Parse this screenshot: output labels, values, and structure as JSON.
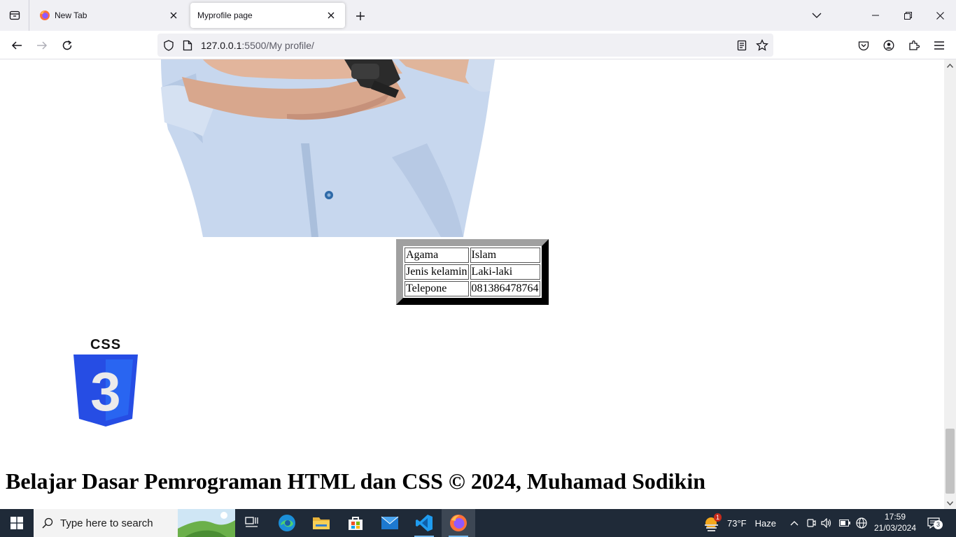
{
  "browser": {
    "tabs": [
      {
        "title": "New Tab",
        "active": false
      },
      {
        "title": "Myprofile page",
        "active": true
      }
    ],
    "url_host": "127.0.0.1",
    "url_rest": ":5500/My profile/"
  },
  "profile_table": [
    {
      "label": "Agama",
      "value": "Islam"
    },
    {
      "label": "Jenis kelamin",
      "value": "Laki-laki"
    },
    {
      "label": "Telepone",
      "value": "081386478764"
    }
  ],
  "css_logo": {
    "text": "CSS",
    "number": "3"
  },
  "footer": "Belajar Dasar Pemrograman HTML dan CSS © 2024, Muhamad Sodikin",
  "taskbar": {
    "search_placeholder": "Type here to search",
    "temperature": "73°F",
    "weather": "Haze",
    "weather_badge": "1",
    "time": "17:59",
    "date": "21/03/2024",
    "notifications": "3"
  },
  "colors": {
    "taskbar": "#1f2a38",
    "tab_strip": "#f0f0f4",
    "css_blue": "#264de4",
    "css_light_blue": "#2965f1"
  },
  "icons": [
    "tab-list-icon",
    "firefox-icon",
    "close-icon",
    "plus-icon",
    "chevron-down-icon",
    "minimize-icon",
    "restore-icon",
    "back-icon",
    "forward-icon",
    "reload-icon",
    "shield-icon",
    "page-icon",
    "reader-view-icon",
    "bookmark-star-icon",
    "pocket-icon",
    "account-icon",
    "extensions-icon",
    "menu-icon",
    "windows-icon",
    "search-icon",
    "task-view-icon",
    "edge-icon",
    "file-explorer-icon",
    "store-icon",
    "mail-icon",
    "vscode-icon",
    "notifications-icon"
  ]
}
